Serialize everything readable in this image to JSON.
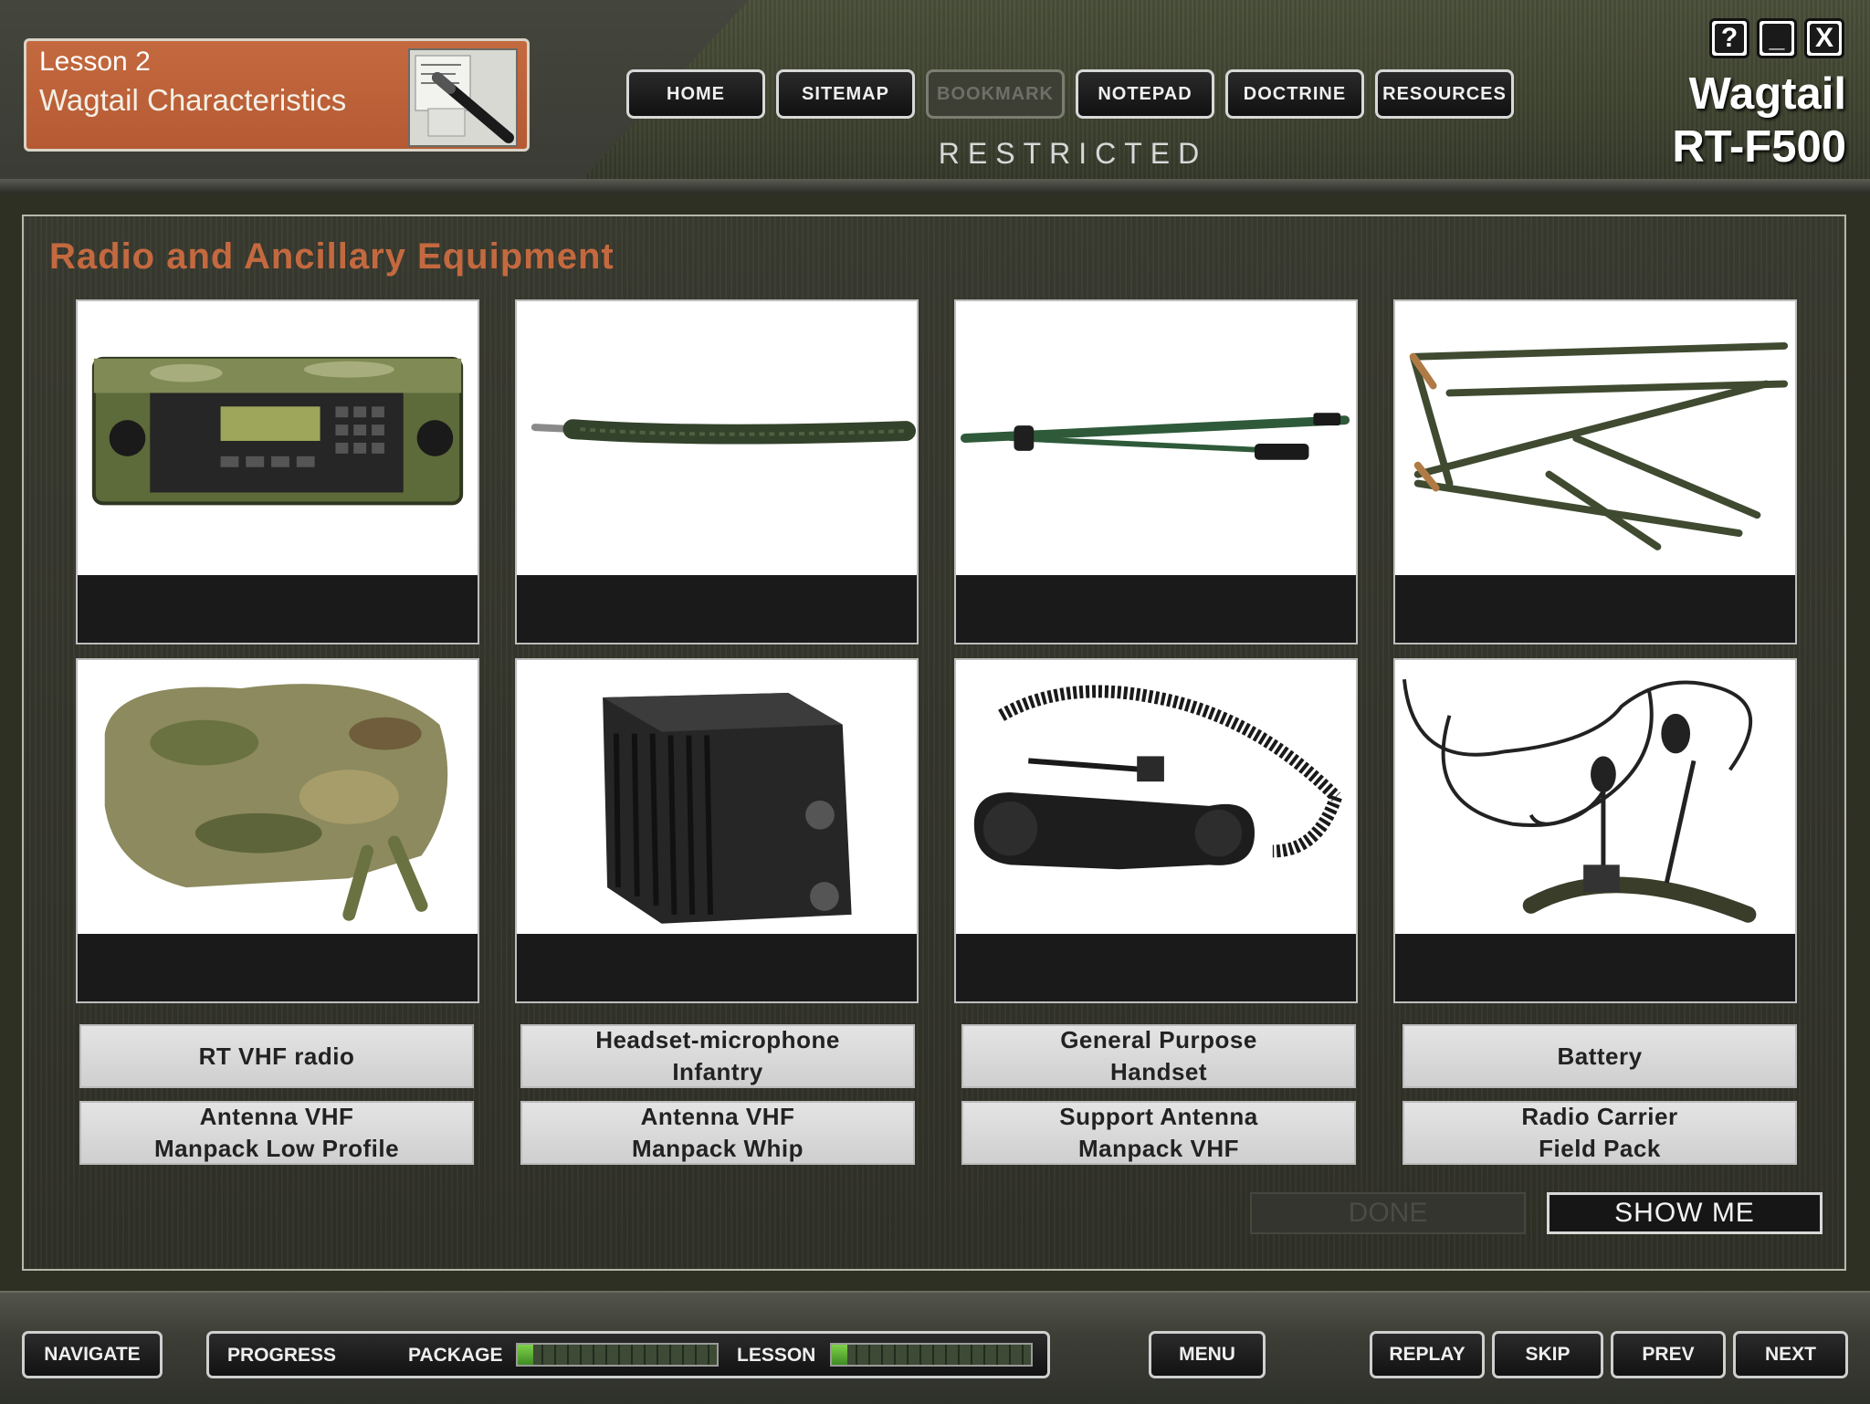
{
  "lesson": {
    "number": "Lesson 2",
    "title": "Wagtail Characteristics"
  },
  "nav": {
    "home": "HOME",
    "sitemap": "SITEMAP",
    "bookmark": "BOOKMARK",
    "notepad": "NOTEPAD",
    "doctrine": "DOCTRINE",
    "resources": "RESOURCES"
  },
  "classification": "RESTRICTED",
  "window_controls": {
    "help": "?",
    "minimize": "_",
    "close": "X"
  },
  "product": {
    "line1": "Wagtail",
    "line2": "RT-F500"
  },
  "main": {
    "section_title": "Radio and Ancillary Equipment",
    "images": [
      "radio-unit",
      "headset-whip-antenna",
      "handset-whip-antenna",
      "support-antenna-frame",
      "field-pack",
      "battery",
      "general-purpose-handset",
      "headset-microphone"
    ],
    "labels": [
      "RT VHF radio",
      "Headset-microphone\nInfantry",
      "General Purpose\nHandset",
      "Battery",
      "Antenna VHF\nManpack Low Profile",
      "Antenna VHF\nManpack Whip",
      "Support Antenna\nManpack VHF",
      "Radio Carrier\nField Pack"
    ],
    "done_label": "DONE",
    "show_me_label": "SHOW ME"
  },
  "bottom": {
    "navigate": "NAVIGATE",
    "progress": "PROGRESS",
    "package": "PACKAGE",
    "lesson": "LESSON",
    "package_progress": 0.08,
    "lesson_progress": 0.08,
    "menu": "MENU",
    "replay": "REPLAY",
    "skip": "SKIP",
    "prev": "PREV",
    "next": "NEXT"
  },
  "colors": {
    "accent": "#c4693f",
    "panel": "#34362c",
    "progress": "#6cc23f"
  }
}
